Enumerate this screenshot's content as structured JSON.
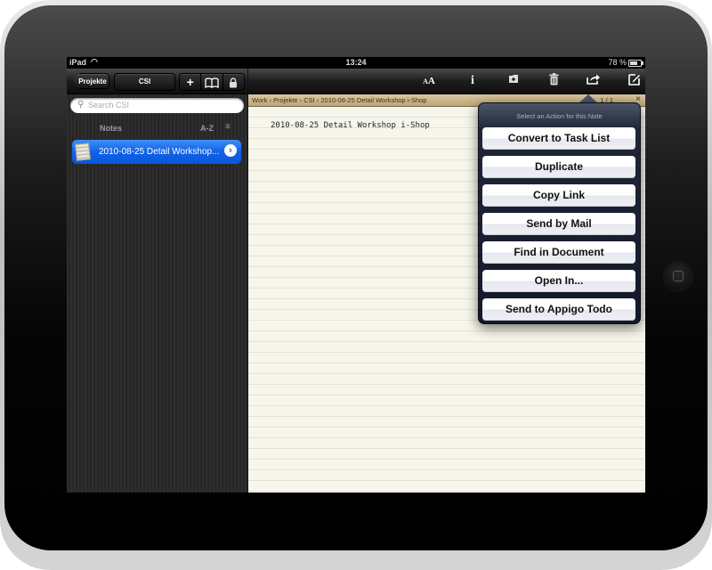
{
  "status_bar": {
    "carrier": "iPad",
    "time": "13:24",
    "battery_percent": "78 %",
    "battery_level": 0.78
  },
  "sidebar": {
    "back_button": "Projekte",
    "title": "CSI",
    "toolbar_buttons": [
      {
        "icon": "plus-icon",
        "glyph": "+"
      },
      {
        "icon": "book-icon",
        "glyph": "🕮"
      },
      {
        "icon": "lock-icon",
        "glyph": "🔒"
      }
    ],
    "search": {
      "placeholder": "Search CSI",
      "value": ""
    },
    "list_header": {
      "title": "Notes",
      "sort_label": "A-Z",
      "sort_icon": "≡"
    },
    "notes": [
      {
        "label": "2010-08-25 Detail Workshop...",
        "selected": true
      }
    ]
  },
  "main_toolbar": {
    "buttons": [
      {
        "name": "font-size",
        "icon": "font-size-icon",
        "glyph": "AA"
      },
      {
        "name": "info",
        "icon": "info-icon",
        "glyph": "i"
      },
      {
        "name": "move-folder",
        "icon": "folder-icon",
        "glyph": "📁"
      },
      {
        "name": "delete",
        "icon": "trash-icon",
        "glyph": "🗑"
      },
      {
        "name": "share",
        "icon": "share-icon",
        "glyph": "↗"
      },
      {
        "name": "compose",
        "icon": "compose-icon",
        "glyph": "✎"
      }
    ]
  },
  "breadcrumb": {
    "path": "Work › Projekte › CSI › 2010-08-25 Detail Workshop i-Shop",
    "page_indicator": "1 / 1",
    "close_glyph": "×"
  },
  "document": {
    "title": "2010-08-25 Detail Workshop i-Shop"
  },
  "popover": {
    "title": "Select an Action for this Note",
    "actions": [
      "Convert to Task List",
      "Duplicate",
      "Copy Link",
      "Send by Mail",
      "Find in Document",
      "Open In...",
      "Send to Appigo Todo"
    ]
  }
}
